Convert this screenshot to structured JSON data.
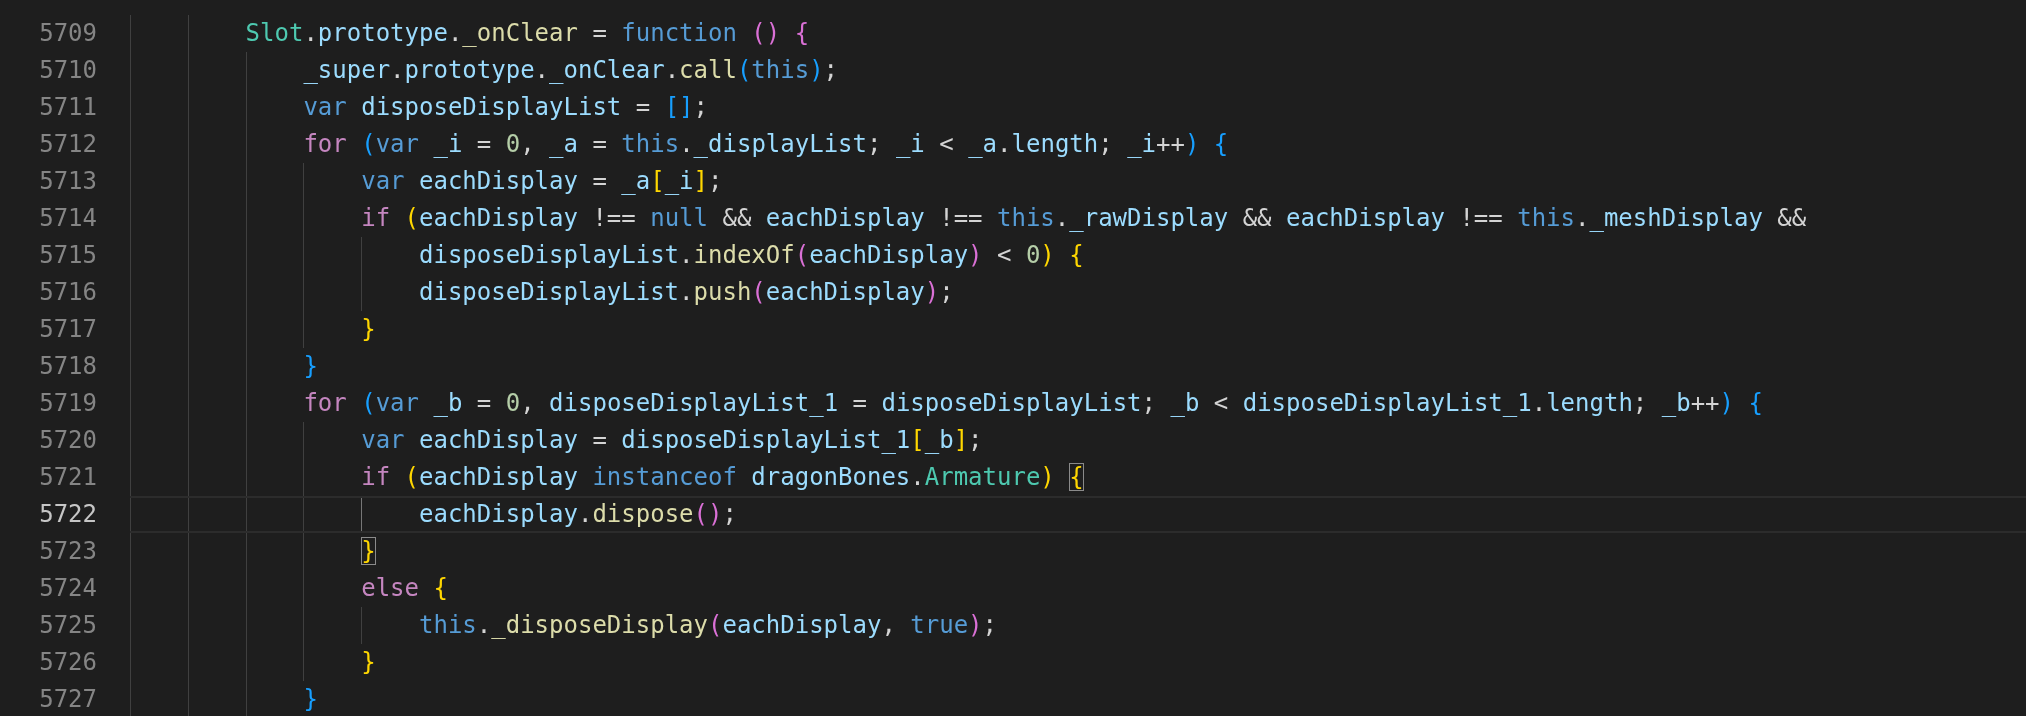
{
  "editor": {
    "lines": [
      {
        "number": "5709",
        "current": false,
        "tokens": [
          {
            "text": "        Slot",
            "kind": "class"
          },
          {
            "text": ".",
            "kind": "plain"
          },
          {
            "text": "prototype",
            "kind": "variable"
          },
          {
            "text": ".",
            "kind": "plain"
          },
          {
            "text": "_onClear",
            "kind": "function"
          },
          {
            "text": " = ",
            "kind": "plain"
          },
          {
            "text": "function",
            "kind": "keyword"
          },
          {
            "text": " ()",
            "kind": "orchid"
          },
          {
            "text": " {",
            "kind": "orchid"
          }
        ]
      },
      {
        "number": "5710",
        "current": false,
        "tokens": [
          {
            "text": "            _super",
            "kind": "variable"
          },
          {
            "text": ".",
            "kind": "plain"
          },
          {
            "text": "prototype",
            "kind": "variable"
          },
          {
            "text": ".",
            "kind": "plain"
          },
          {
            "text": "_onClear",
            "kind": "variable"
          },
          {
            "text": ".",
            "kind": "plain"
          },
          {
            "text": "call",
            "kind": "function"
          },
          {
            "text": "(",
            "kind": "blue"
          },
          {
            "text": "this",
            "kind": "keyword"
          },
          {
            "text": ")",
            "kind": "blue"
          },
          {
            "text": ";",
            "kind": "plain"
          }
        ]
      },
      {
        "number": "5711",
        "current": false,
        "tokens": [
          {
            "text": "            var",
            "kind": "keyword"
          },
          {
            "text": " disposeDisplayList",
            "kind": "variable"
          },
          {
            "text": " = ",
            "kind": "plain"
          },
          {
            "text": "[]",
            "kind": "blue"
          },
          {
            "text": ";",
            "kind": "plain"
          }
        ]
      },
      {
        "number": "5712",
        "current": false,
        "tokens": [
          {
            "text": "            for",
            "kind": "control"
          },
          {
            "text": " (",
            "kind": "blue"
          },
          {
            "text": "var",
            "kind": "keyword"
          },
          {
            "text": " _i",
            "kind": "variable"
          },
          {
            "text": " = ",
            "kind": "plain"
          },
          {
            "text": "0",
            "kind": "number"
          },
          {
            "text": ", ",
            "kind": "plain"
          },
          {
            "text": "_a",
            "kind": "variable"
          },
          {
            "text": " = ",
            "kind": "plain"
          },
          {
            "text": "this",
            "kind": "keyword"
          },
          {
            "text": ".",
            "kind": "plain"
          },
          {
            "text": "_displayList",
            "kind": "variable"
          },
          {
            "text": "; ",
            "kind": "plain"
          },
          {
            "text": "_i",
            "kind": "variable"
          },
          {
            "text": " < ",
            "kind": "plain"
          },
          {
            "text": "_a",
            "kind": "variable"
          },
          {
            "text": ".",
            "kind": "plain"
          },
          {
            "text": "length",
            "kind": "variable"
          },
          {
            "text": "; ",
            "kind": "plain"
          },
          {
            "text": "_i",
            "kind": "variable"
          },
          {
            "text": "++",
            "kind": "plain"
          },
          {
            "text": ")",
            "kind": "blue"
          },
          {
            "text": " {",
            "kind": "blue"
          }
        ]
      },
      {
        "number": "5713",
        "current": false,
        "tokens": [
          {
            "text": "                var",
            "kind": "keyword"
          },
          {
            "text": " eachDisplay",
            "kind": "variable"
          },
          {
            "text": " = ",
            "kind": "plain"
          },
          {
            "text": "_a",
            "kind": "variable"
          },
          {
            "text": "[",
            "kind": "gold"
          },
          {
            "text": "_i",
            "kind": "variable"
          },
          {
            "text": "]",
            "kind": "gold"
          },
          {
            "text": ";",
            "kind": "plain"
          }
        ]
      },
      {
        "number": "5714",
        "current": false,
        "tokens": [
          {
            "text": "                if",
            "kind": "control"
          },
          {
            "text": " (",
            "kind": "gold"
          },
          {
            "text": "eachDisplay",
            "kind": "variable"
          },
          {
            "text": " !== ",
            "kind": "plain"
          },
          {
            "text": "null",
            "kind": "keyword"
          },
          {
            "text": " && ",
            "kind": "plain"
          },
          {
            "text": "eachDisplay",
            "kind": "variable"
          },
          {
            "text": " !== ",
            "kind": "plain"
          },
          {
            "text": "this",
            "kind": "keyword"
          },
          {
            "text": ".",
            "kind": "plain"
          },
          {
            "text": "_rawDisplay",
            "kind": "variable"
          },
          {
            "text": " && ",
            "kind": "plain"
          },
          {
            "text": "eachDisplay",
            "kind": "variable"
          },
          {
            "text": " !== ",
            "kind": "plain"
          },
          {
            "text": "this",
            "kind": "keyword"
          },
          {
            "text": ".",
            "kind": "plain"
          },
          {
            "text": "_meshDisplay",
            "kind": "variable"
          },
          {
            "text": " &&",
            "kind": "plain"
          }
        ]
      },
      {
        "number": "5715",
        "current": false,
        "tokens": [
          {
            "text": "                    disposeDisplayList",
            "kind": "variable"
          },
          {
            "text": ".",
            "kind": "plain"
          },
          {
            "text": "indexOf",
            "kind": "function"
          },
          {
            "text": "(",
            "kind": "orchid"
          },
          {
            "text": "eachDisplay",
            "kind": "variable"
          },
          {
            "text": ")",
            "kind": "orchid"
          },
          {
            "text": " < ",
            "kind": "plain"
          },
          {
            "text": "0",
            "kind": "number"
          },
          {
            "text": ")",
            "kind": "gold"
          },
          {
            "text": " {",
            "kind": "gold"
          }
        ]
      },
      {
        "number": "5716",
        "current": false,
        "tokens": [
          {
            "text": "                    disposeDisplayList",
            "kind": "variable"
          },
          {
            "text": ".",
            "kind": "plain"
          },
          {
            "text": "push",
            "kind": "function"
          },
          {
            "text": "(",
            "kind": "orchid"
          },
          {
            "text": "eachDisplay",
            "kind": "variable"
          },
          {
            "text": ")",
            "kind": "orchid"
          },
          {
            "text": ";",
            "kind": "plain"
          }
        ]
      },
      {
        "number": "5717",
        "current": false,
        "tokens": [
          {
            "text": "                }",
            "kind": "gold"
          }
        ]
      },
      {
        "number": "5718",
        "current": false,
        "tokens": [
          {
            "text": "            }",
            "kind": "blue"
          }
        ]
      },
      {
        "number": "5719",
        "current": false,
        "tokens": [
          {
            "text": "            for",
            "kind": "control"
          },
          {
            "text": " (",
            "kind": "blue"
          },
          {
            "text": "var",
            "kind": "keyword"
          },
          {
            "text": " _b",
            "kind": "variable"
          },
          {
            "text": " = ",
            "kind": "plain"
          },
          {
            "text": "0",
            "kind": "number"
          },
          {
            "text": ", ",
            "kind": "plain"
          },
          {
            "text": "disposeDisplayList_1",
            "kind": "variable"
          },
          {
            "text": " = ",
            "kind": "plain"
          },
          {
            "text": "disposeDisplayList",
            "kind": "variable"
          },
          {
            "text": "; ",
            "kind": "plain"
          },
          {
            "text": "_b",
            "kind": "variable"
          },
          {
            "text": " < ",
            "kind": "plain"
          },
          {
            "text": "disposeDisplayList_1",
            "kind": "variable"
          },
          {
            "text": ".",
            "kind": "plain"
          },
          {
            "text": "length",
            "kind": "variable"
          },
          {
            "text": "; ",
            "kind": "plain"
          },
          {
            "text": "_b",
            "kind": "variable"
          },
          {
            "text": "++",
            "kind": "plain"
          },
          {
            "text": ")",
            "kind": "blue"
          },
          {
            "text": " {",
            "kind": "blue"
          }
        ]
      },
      {
        "number": "5720",
        "current": false,
        "tokens": [
          {
            "text": "                var",
            "kind": "keyword"
          },
          {
            "text": " eachDisplay",
            "kind": "variable"
          },
          {
            "text": " = ",
            "kind": "plain"
          },
          {
            "text": "disposeDisplayList_1",
            "kind": "variable"
          },
          {
            "text": "[",
            "kind": "gold"
          },
          {
            "text": "_b",
            "kind": "variable"
          },
          {
            "text": "]",
            "kind": "gold"
          },
          {
            "text": ";",
            "kind": "plain"
          }
        ]
      },
      {
        "number": "5721",
        "current": false,
        "tokens": [
          {
            "text": "                if",
            "kind": "control"
          },
          {
            "text": " (",
            "kind": "gold"
          },
          {
            "text": "eachDisplay",
            "kind": "variable"
          },
          {
            "text": " instanceof",
            "kind": "keyword"
          },
          {
            "text": " dragonBones",
            "kind": "variable"
          },
          {
            "text": ".",
            "kind": "plain"
          },
          {
            "text": "Armature",
            "kind": "class"
          },
          {
            "text": ")",
            "kind": "gold"
          },
          {
            "text": " {",
            "kind": "gold",
            "matched": true
          }
        ]
      },
      {
        "number": "5722",
        "current": true,
        "tokens": [
          {
            "text": "                    eachDisplay",
            "kind": "variable"
          },
          {
            "text": ".",
            "kind": "plain"
          },
          {
            "text": "dispose",
            "kind": "function"
          },
          {
            "text": "()",
            "kind": "orchid"
          },
          {
            "text": ";",
            "kind": "plain"
          }
        ]
      },
      {
        "number": "5723",
        "current": false,
        "tokens": [
          {
            "text": "                }",
            "kind": "gold",
            "matched": true
          }
        ]
      },
      {
        "number": "5724",
        "current": false,
        "tokens": [
          {
            "text": "                else",
            "kind": "control"
          },
          {
            "text": " {",
            "kind": "gold"
          }
        ]
      },
      {
        "number": "5725",
        "current": false,
        "tokens": [
          {
            "text": "                    this",
            "kind": "keyword"
          },
          {
            "text": ".",
            "kind": "plain"
          },
          {
            "text": "_disposeDisplay",
            "kind": "function"
          },
          {
            "text": "(",
            "kind": "orchid"
          },
          {
            "text": "eachDisplay",
            "kind": "variable"
          },
          {
            "text": ", ",
            "kind": "plain"
          },
          {
            "text": "true",
            "kind": "keyword"
          },
          {
            "text": ")",
            "kind": "orchid"
          },
          {
            "text": ";",
            "kind": "plain"
          }
        ]
      },
      {
        "number": "5726",
        "current": false,
        "tokens": [
          {
            "text": "                }",
            "kind": "gold"
          }
        ]
      },
      {
        "number": "5727",
        "current": false,
        "tokens": [
          {
            "text": "            }",
            "kind": "blue"
          }
        ]
      }
    ]
  }
}
